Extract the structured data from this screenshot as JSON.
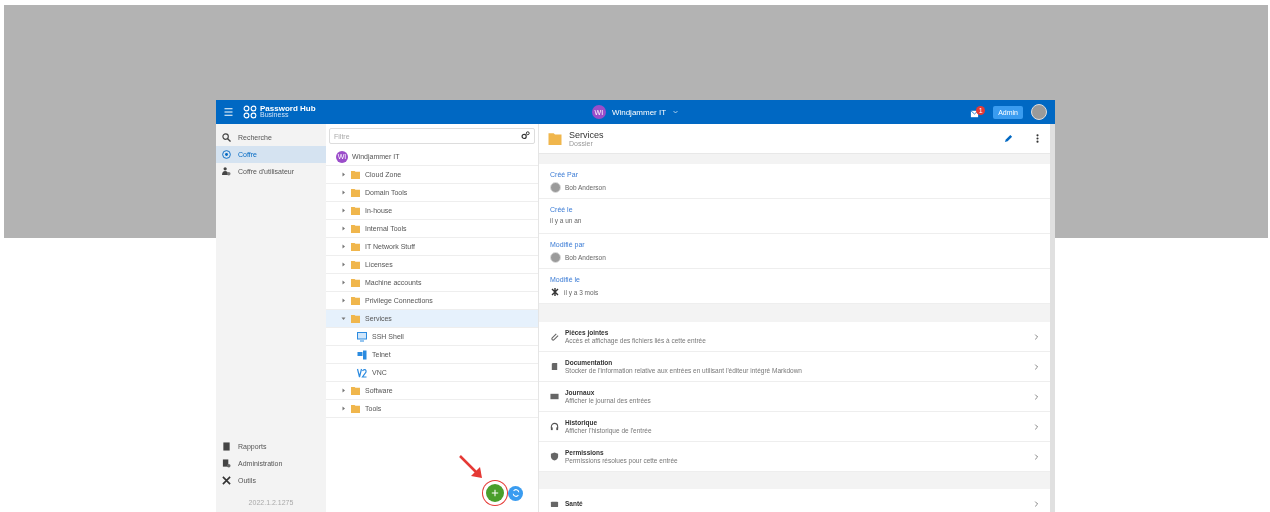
{
  "header": {
    "logo_title": "Password Hub",
    "logo_subtitle": "Business",
    "workspace": {
      "initials": "WI",
      "name": "Windjammer IT"
    },
    "notification_count": "1",
    "role_badge": "Admin"
  },
  "sidebar": {
    "items": [
      {
        "label": "Recherche",
        "kind": "search",
        "selected": false
      },
      {
        "label": "Coffre",
        "kind": "vault",
        "selected": true
      },
      {
        "label": "Coffre d'utilisateur",
        "kind": "user-vault",
        "selected": false
      }
    ],
    "bottom_items": [
      {
        "label": "Rapports",
        "kind": "reports"
      },
      {
        "label": "Administration",
        "kind": "admin"
      },
      {
        "label": "Outils",
        "kind": "tools"
      }
    ],
    "version": "2022.1.2.1275"
  },
  "tree": {
    "filter_placeholder": "Filtre",
    "root": {
      "initials": "WI",
      "name": "Windjammer IT"
    },
    "items": [
      {
        "label": "Cloud Zone",
        "kind": "folder",
        "expanded": false,
        "selected": false
      },
      {
        "label": "Domain Tools",
        "kind": "folder",
        "expanded": false,
        "selected": false
      },
      {
        "label": "In-house",
        "kind": "folder",
        "expanded": false,
        "selected": false
      },
      {
        "label": "Internal Tools",
        "kind": "folder",
        "expanded": false,
        "selected": false
      },
      {
        "label": "IT Network Stuff",
        "kind": "folder",
        "expanded": false,
        "selected": false
      },
      {
        "label": "Licenses",
        "kind": "folder",
        "expanded": false,
        "selected": false
      },
      {
        "label": "Machine accounts",
        "kind": "folder",
        "expanded": false,
        "selected": false
      },
      {
        "label": "Privilege Connections",
        "kind": "folder",
        "expanded": false,
        "selected": false
      },
      {
        "label": "Services",
        "kind": "folder",
        "expanded": true,
        "selected": true,
        "children": [
          {
            "label": "SSH Shell",
            "kind": "ssh",
            "selected": false
          },
          {
            "label": "Telnet",
            "kind": "telnet",
            "selected": false
          },
          {
            "label": "VNC",
            "kind": "vnc",
            "selected": false
          }
        ]
      },
      {
        "label": "Software",
        "kind": "folder",
        "expanded": false,
        "selected": false
      },
      {
        "label": "Tools",
        "kind": "folder",
        "expanded": false,
        "selected": false
      }
    ]
  },
  "details": {
    "title": "Services",
    "subtitle": "Dossier",
    "fields": [
      {
        "label": "Créé Par",
        "value": "Bob Anderson",
        "kind": "user"
      },
      {
        "label": "Créé le",
        "value": "il y a un an",
        "kind": "text"
      },
      {
        "label": "Modifié par",
        "value": "Bob Anderson",
        "kind": "user"
      },
      {
        "label": "Modifié le",
        "value": "il y a 3 mois",
        "kind": "system"
      }
    ],
    "sections": [
      {
        "title": "Pièces jointes",
        "description": "Accès et affichage des fichiers liés à cette entrée",
        "kind": "attachments"
      },
      {
        "title": "Documentation",
        "description": "Stocker de l'information relative aux entrées en utilisant l'éditeur intégré Markdown",
        "kind": "documentation"
      },
      {
        "title": "Journaux",
        "description": "Afficher le journal des entrées",
        "kind": "logs"
      },
      {
        "title": "Historique",
        "description": "Afficher l'historique de l'entrée",
        "kind": "history"
      },
      {
        "title": "Permissions",
        "description": "Permissions résolues pour cette entrée",
        "kind": "permissions"
      }
    ],
    "more_sections": [
      {
        "title": "Santé",
        "kind": "health"
      }
    ]
  }
}
